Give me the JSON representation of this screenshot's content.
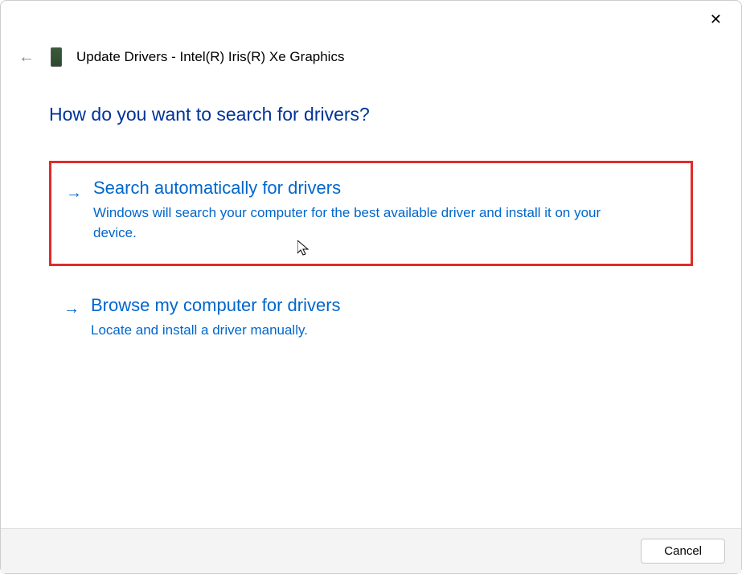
{
  "titlebar": {
    "close_label": "✕"
  },
  "header": {
    "back_arrow": "←",
    "title": "Update Drivers - Intel(R) Iris(R) Xe Graphics"
  },
  "page_heading": "How do you want to search for drivers?",
  "options": {
    "auto": {
      "arrow": "→",
      "title": "Search automatically for drivers",
      "desc": "Windows will search your computer for the best available driver and install it on your device."
    },
    "browse": {
      "arrow": "→",
      "title": "Browse my computer for drivers",
      "desc": "Locate and install a driver manually."
    }
  },
  "footer": {
    "cancel_label": "Cancel"
  }
}
